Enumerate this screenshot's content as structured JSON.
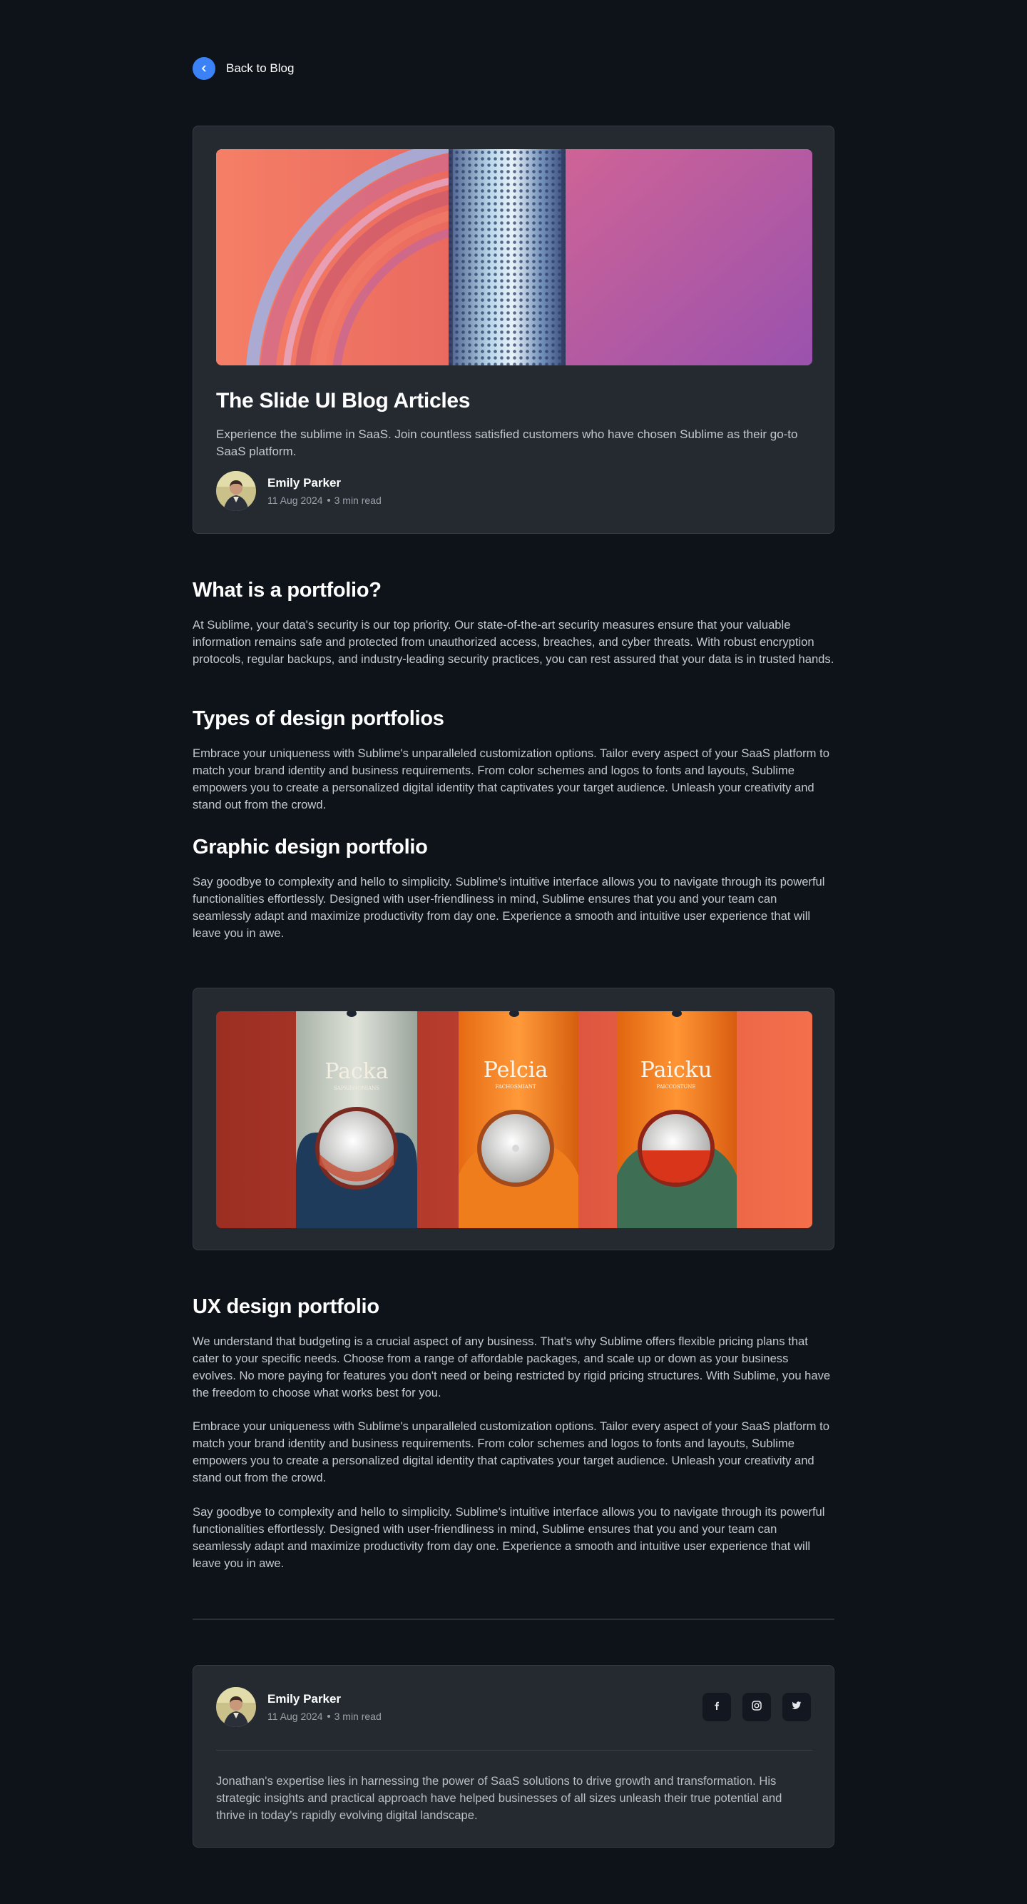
{
  "nav": {
    "back_label": "Back to Blog"
  },
  "hero": {
    "title": "The Slide UI Blog Articles",
    "description": "Experience the sublime in SaaS. Join countless satisfied customers who have chosen Sublime as their go-to SaaS platform.",
    "author": {
      "name": "Emily Parker",
      "date": "11 Aug 2024",
      "read_time": "3 min read"
    }
  },
  "article": {
    "sections": [
      {
        "heading": "What is a portfolio?",
        "body": "At Sublime, your data's security is our top priority. Our state-of-the-art security measures ensure that your valuable information remains safe and protected from unauthorized access, breaches, and cyber threats. With robust encryption protocols, regular backups, and industry-leading security practices, you can rest assured that your data is in trusted hands."
      },
      {
        "heading": "Types of design portfolios",
        "body": "Embrace your uniqueness with Sublime's unparalleled customization options. Tailor every aspect of your SaaS platform to match your brand identity and business requirements. From color schemes and logos to fonts and layouts, Sublime empowers you to create a personalized digital identity that captivates your target audience. Unleash your creativity and stand out from the crowd."
      },
      {
        "heading": "Graphic design portfolio",
        "body": "Say goodbye to complexity and hello to simplicity. Sublime's intuitive interface allows you to navigate through its powerful functionalities effortlessly. Designed with user-friendliness in mind, Sublime ensures that you and your team can seamlessly adapt and maximize productivity from day one. Experience a smooth and intuitive user experience that will leave you in awe."
      }
    ],
    "ux": {
      "heading": "UX design portfolio",
      "paragraphs": [
        "We understand that budgeting is a crucial aspect of any business. That's why Sublime offers flexible pricing plans that cater to your specific needs. Choose from a range of affordable packages, and scale up or down as your business evolves. No more paying for features you don't need or being restricted by rigid pricing structures. With Sublime, you have the freedom to choose what works best for you.",
        "Embrace your uniqueness with Sublime's unparalleled customization options. Tailor every aspect of your SaaS platform to match your brand identity and business requirements. From color schemes and logos to fonts and layouts, Sublime empowers you to create a personalized digital identity that captivates your target audience. Unleash your creativity and stand out from the crowd.",
        "Say goodbye to complexity and hello to simplicity. Sublime's intuitive interface allows you to navigate through its powerful functionalities effortlessly. Designed with user-friendliness in mind, Sublime ensures that you and your team can seamlessly adapt and maximize productivity from day one. Experience a smooth and intuitive user experience that will leave you in awe."
      ]
    }
  },
  "product_image": {
    "labels": [
      "Packa",
      "Pelcia",
      "Paicku"
    ],
    "sublabels": [
      "SAPRINSONIANS",
      "FACHOSMIANT",
      "PAICCOSTUNE"
    ]
  },
  "bio": {
    "author": {
      "name": "Emily Parker",
      "date": "11 Aug 2024",
      "read_time": "3 min read"
    },
    "text": "Jonathan's expertise lies in harnessing the power of SaaS solutions to drive growth and transformation. His strategic insights and practical approach have helped businesses of all sizes unleash their true potential and thrive in today's rapidly evolving digital landscape.",
    "socials": [
      "facebook-icon",
      "instagram-icon",
      "twitter-icon"
    ]
  },
  "colors": {
    "accent": "#3b82f6",
    "background": "#0e1219",
    "card": "#252a31"
  }
}
